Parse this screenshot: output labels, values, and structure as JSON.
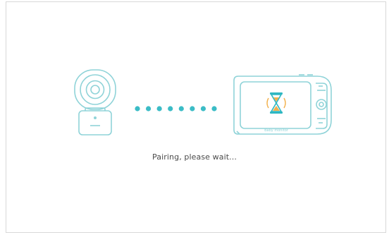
{
  "status": {
    "message": "Pairing, please wait..."
  },
  "monitor": {
    "screen_label": "Baby monitor"
  },
  "pairing": {
    "dot_count": 8
  },
  "colors": {
    "outline": "#8fd3d8",
    "dots": "#3bbcc6",
    "hourglass_glass": "#2fb7c2",
    "hourglass_sand": "#f2b14d",
    "text": "#4a4a4a",
    "frame_border": "#d8d8d8"
  },
  "icons": {
    "camera": "baby-camera-icon",
    "monitor": "parent-monitor-icon",
    "hourglass": "hourglass-icon"
  }
}
